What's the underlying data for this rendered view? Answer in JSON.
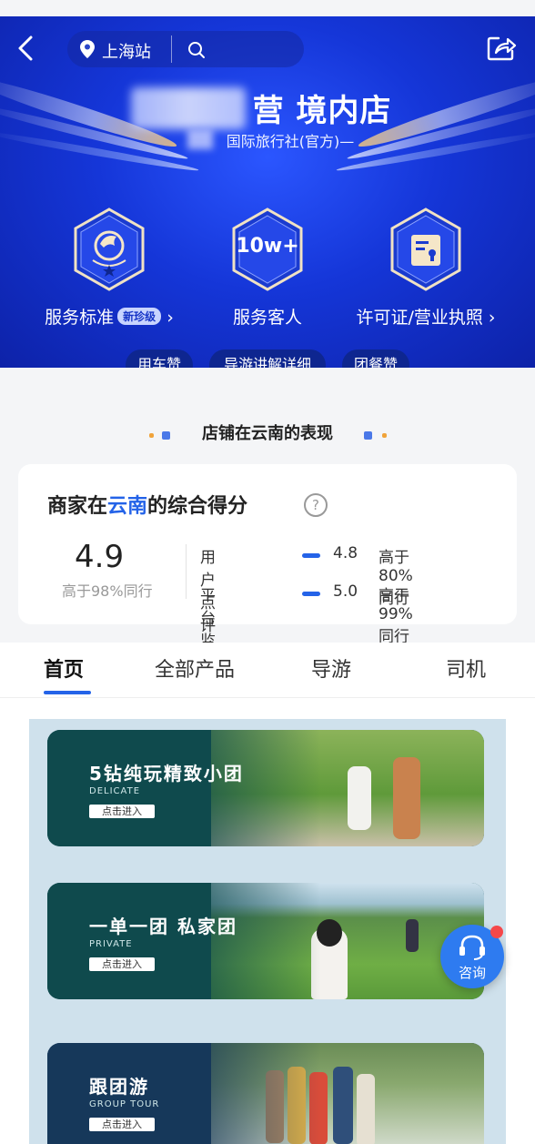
{
  "header": {
    "location": "上海站",
    "shop_title": "营 境内店",
    "shop_subtitle": "国际旅行社(官方)—",
    "badges": [
      {
        "label": "服务标准",
        "tag": "新珍级",
        "icon_text": "",
        "arrow": "›"
      },
      {
        "label": "服务客人",
        "icon_text": "10w+",
        "arrow": ""
      },
      {
        "label": "许可证/营业执照",
        "icon_text": "",
        "arrow": "›"
      }
    ],
    "tags": [
      "用车赞",
      "导游讲解详细",
      "团餐赞"
    ]
  },
  "performance": {
    "heading": "店铺在云南的表现",
    "score_title_pre": "商家在",
    "score_title_region": "云南",
    "score_title_post": "的综合得分",
    "help_icon": "?",
    "overall_score": "4.9",
    "overall_rank": "高于98%同行",
    "metrics": [
      {
        "name": "用户点评分",
        "value": "4.8",
        "rank": "高于80%同行"
      },
      {
        "name": "平台监控分",
        "value": "5.0",
        "rank": "高于99%同行"
      }
    ]
  },
  "tabs": [
    "首页",
    "全部产品",
    "导游",
    "司机"
  ],
  "active_tab": "首页",
  "banners": [
    {
      "title": "5钻纯玩精致小团",
      "subtitle": "DELICATE",
      "button": "点击进入"
    },
    {
      "title": "一单一团 私家团",
      "subtitle": "PRIVATE",
      "button": "点击进入"
    },
    {
      "title": "跟团游",
      "subtitle": "GROUP TOUR",
      "button": "点击进入"
    }
  ],
  "consult": {
    "label": "咨询"
  },
  "colors": {
    "brand_blue": "#1536d8",
    "accent_blue": "#2463e8",
    "banner_teal": "#0f4a4d",
    "badge_red": "#f5484a"
  }
}
